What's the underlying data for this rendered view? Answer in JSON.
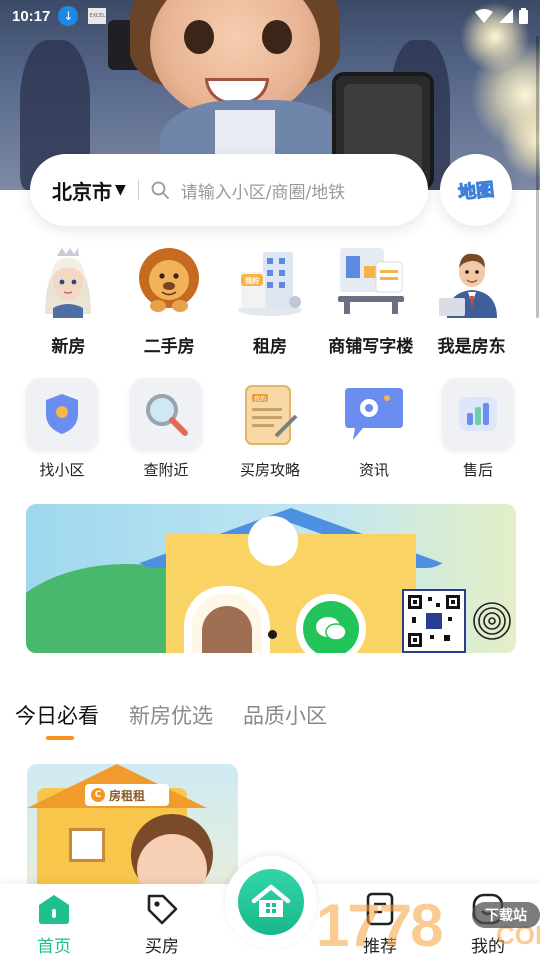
{
  "status_bar": {
    "time": "10:17",
    "download_icon": "download-icon",
    "tiny_badge": "EXCEL"
  },
  "search": {
    "city": "北京市",
    "placeholder": "请输入小区/商圈/地铁"
  },
  "map_button": {
    "label": "地图"
  },
  "primary_categories": [
    {
      "label": "新房",
      "icon": "princess-avatar"
    },
    {
      "label": "二手房",
      "icon": "lion-avatar"
    },
    {
      "label": "租房",
      "icon": "apartment-building"
    },
    {
      "label": "商铺写字楼",
      "icon": "office-desk"
    },
    {
      "label": "我是房东",
      "icon": "landlord-avatar"
    }
  ],
  "secondary_categories": [
    {
      "label": "找小区",
      "icon": "shield-icon"
    },
    {
      "label": "查附近",
      "icon": "magnifier-icon"
    },
    {
      "label": "买房攻略",
      "icon": "notepad-icon",
      "icon_text": "我的"
    },
    {
      "label": "资讯",
      "icon": "chat-bubble-icon"
    },
    {
      "label": "售后",
      "icon": "bar-chart-icon"
    }
  ],
  "banner": {
    "carousel_position": 1
  },
  "feed_tabs": [
    {
      "label": "今日必看",
      "active": true
    },
    {
      "label": "新房优选",
      "active": false
    },
    {
      "label": "品质小区",
      "active": false
    }
  ],
  "cards": [
    {
      "sign_text": "房租租",
      "sign_badge": "C"
    }
  ],
  "rent_sign_small": "我的",
  "bottom_nav": {
    "home": "首页",
    "buy": "买房",
    "recommend": "推荐",
    "mine": "我的"
  },
  "watermark": {
    "digits": "1778",
    "suffix": "COM",
    "tag": "下载站"
  },
  "colors": {
    "accent_green": "#1fbf8f",
    "tab_indicator": "#f7941d",
    "placeholder": "#9a9a9a"
  }
}
